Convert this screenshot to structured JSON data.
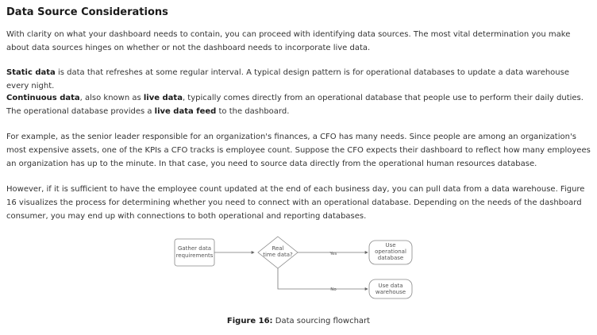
{
  "heading": "Data Source Considerations",
  "p1": {
    "text": "With clarity on what your dashboard needs to contain, you can proceed with identifying data sources. The most vital determination you make about data sources hinges on whether or not the dashboard needs to incorporate live data."
  },
  "p2": {
    "term": "Static data",
    "text": " is data that refreshes at some regular interval. A typical design pattern is for operational databases to update a data warehouse every night."
  },
  "p3": {
    "term1": "Continuous data",
    "text1": ", also known as ",
    "term2": "live data",
    "text2": ", typically comes directly from an operational database that people use to perform their daily duties. The operational database provides a ",
    "term3": "live data feed",
    "text3": " to the dashboard."
  },
  "p4": {
    "text": "For example, as the senior leader responsible for an organization's finances, a CFO has many needs. Since people are among an organization's most expensive assets, one of the KPIs a CFO tracks is employee count. Suppose the CFO expects their dashboard to reflect how many employees an organization has up to the minute. In that case, you need to source data directly from the operational human resources database."
  },
  "p5": {
    "text": "However, if it is sufficient to have the employee count updated at the end of each business day, you can pull data from a data warehouse. Figure 16 visualizes the process for determining whether you need to connect with an operational database. Depending on the needs of the dashboard consumer, you may end up with connections to both operational and reporting databases."
  },
  "flowchart": {
    "start": [
      "Gather data",
      "requirements"
    ],
    "decision": [
      "Real",
      "time data?"
    ],
    "yes_label": "Yes",
    "no_label": "No",
    "yes_target": [
      "Use",
      "operational",
      "database"
    ],
    "no_target": [
      "Use data",
      "warehouse"
    ]
  },
  "caption": {
    "label": "Figure 16:",
    "text": " Data sourcing flowchart"
  }
}
